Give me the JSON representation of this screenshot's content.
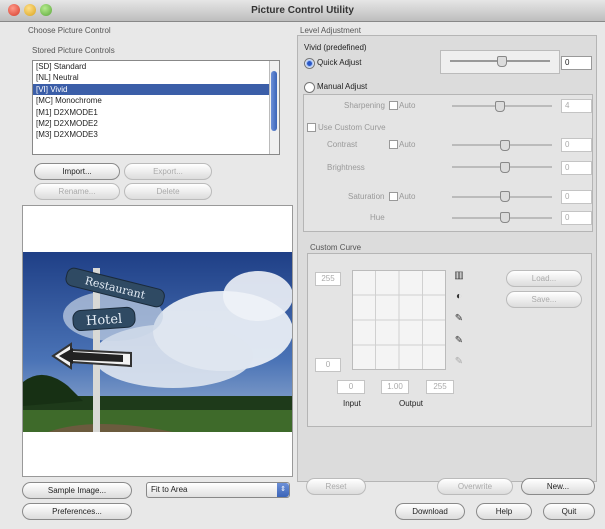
{
  "window": {
    "title": "Picture Control Utility"
  },
  "choose": {
    "section_title": "Choose Picture Control",
    "list_title": "Stored Picture Controls",
    "items": [
      "[SD] Standard",
      "[NL] Neutral",
      "[VI] Vivid",
      "[MC] Monochrome",
      "[M1] D2XMODE1",
      "[M2] D2XMODE2",
      "[M3] D2XMODE3"
    ],
    "selected_index": 2,
    "import_label": "Import...",
    "export_label": "Export...",
    "rename_label": "Rename...",
    "delete_label": "Delete"
  },
  "level": {
    "section_title": "Level Adjustment",
    "preset_label": "Vivid (predefined)",
    "quick_adjust_label": "Quick Adjust",
    "quick_adjust_value": "0",
    "manual_adjust_label": "Manual Adjust",
    "sharpening_label": "Sharpening",
    "sharpening_value": "4",
    "auto_label": "Auto",
    "use_custom_curve_label": "Use Custom Curve",
    "contrast_label": "Contrast",
    "contrast_value": "0",
    "brightness_label": "Brightness",
    "brightness_value": "0",
    "saturation_label": "Saturation",
    "saturation_value": "0",
    "hue_label": "Hue",
    "hue_value": "0"
  },
  "curve": {
    "section_title": "Custom Curve",
    "top_value": "255",
    "bottom_value": "0",
    "input_value": "0",
    "gamma_value": "1.00",
    "output_value": "255",
    "input_label": "Input",
    "output_label": "Output",
    "load_label": "Load...",
    "save_label": "Save..."
  },
  "bottom": {
    "sample_image_label": "Sample Image...",
    "fit_option": "Fit to Area",
    "preferences_label": "Preferences...",
    "reset_label": "Reset",
    "overwrite_label": "Overwrite",
    "new_label": "New...",
    "download_label": "Download",
    "help_label": "Help",
    "quit_label": "Quit"
  },
  "photo": {
    "sign_top": "Restaurant",
    "sign_mid": "Hotel"
  }
}
